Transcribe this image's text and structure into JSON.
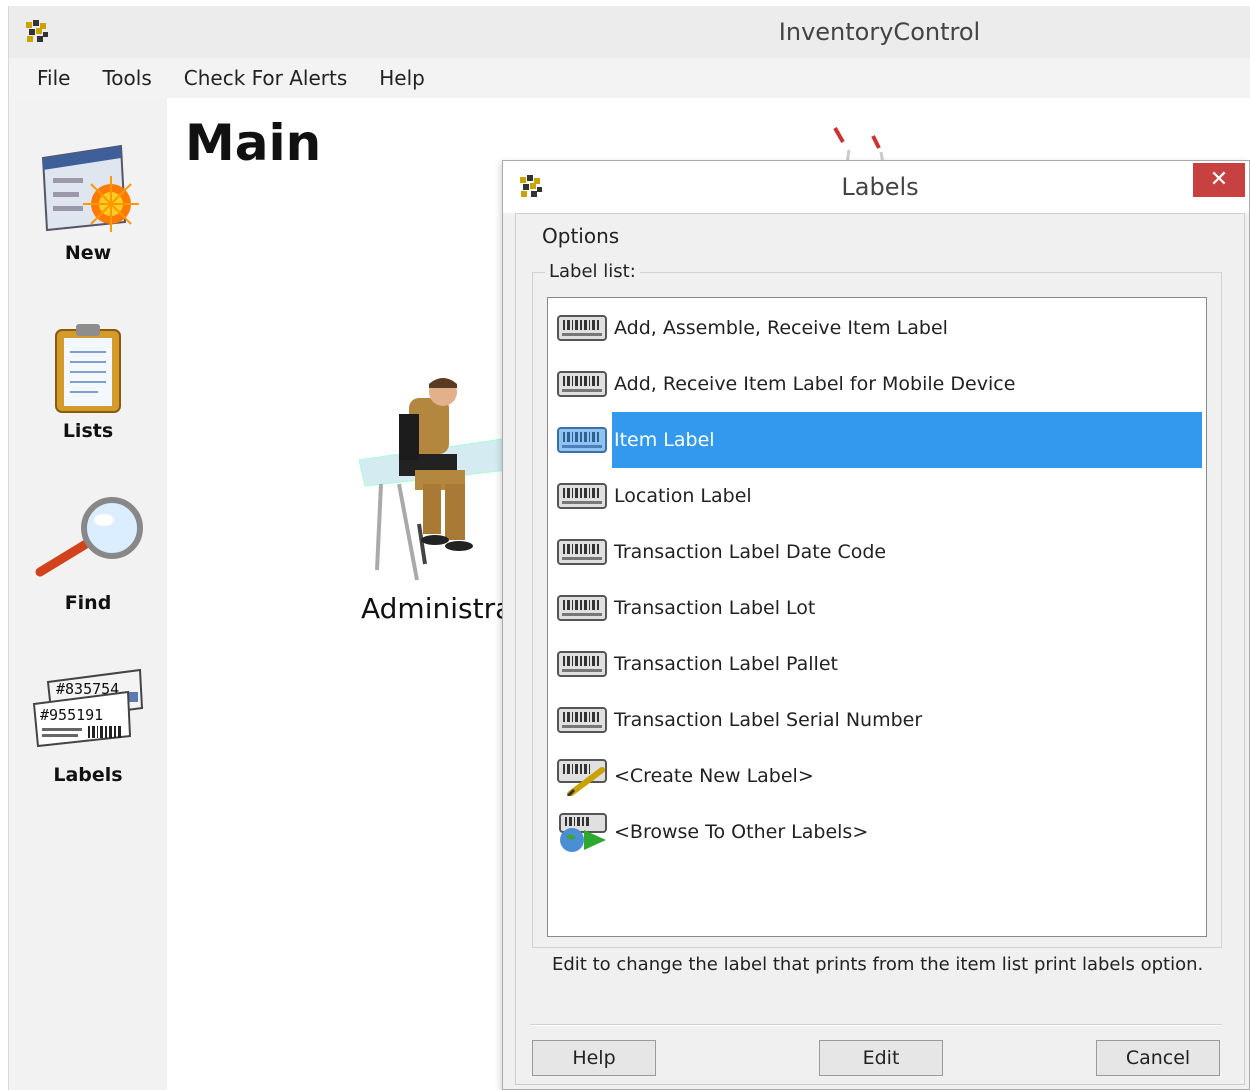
{
  "window": {
    "title": "InventoryControl"
  },
  "menu": {
    "items": [
      "File",
      "Tools",
      "Check For Alerts",
      "Help"
    ]
  },
  "sidebar": {
    "buttons": [
      {
        "label": "New",
        "icon": "new-form-icon"
      },
      {
        "label": "Lists",
        "icon": "clipboard-icon"
      },
      {
        "label": "Find",
        "icon": "magnifier-icon"
      },
      {
        "label": "Labels",
        "icon": "barcode-labels-icon",
        "icon_text_1": "#835754",
        "icon_text_2": "#955191"
      }
    ]
  },
  "main": {
    "heading": "Main",
    "role_label": "Administra"
  },
  "dialog": {
    "title": "Labels",
    "close_label": "✕",
    "options_tab": "Options",
    "group_label": "Label list:",
    "items": [
      {
        "label": "Add, Assemble, Receive Item Label",
        "icon": "barcode-label-icon"
      },
      {
        "label": "Add, Receive Item Label for Mobile Device",
        "icon": "barcode-label-icon"
      },
      {
        "label": "Item Label",
        "icon": "barcode-label-icon",
        "selected": true
      },
      {
        "label": "Location Label",
        "icon": "barcode-label-icon"
      },
      {
        "label": "Transaction Label Date Code",
        "icon": "barcode-label-icon"
      },
      {
        "label": "Transaction Label Lot",
        "icon": "barcode-label-icon"
      },
      {
        "label": "Transaction Label Pallet",
        "icon": "barcode-label-icon"
      },
      {
        "label": "Transaction Label Serial Number",
        "icon": "barcode-label-icon"
      },
      {
        "label": "<Create New Label>",
        "icon": "create-label-icon"
      },
      {
        "label": "<Browse To Other Labels>",
        "icon": "browse-labels-icon"
      }
    ],
    "hint": "Edit to change the label that prints from the item list print labels option.",
    "buttons": {
      "help": "Help",
      "edit": "Edit",
      "cancel": "Cancel"
    },
    "colors": {
      "selection": "#3399ee",
      "close": "#c74141"
    }
  }
}
